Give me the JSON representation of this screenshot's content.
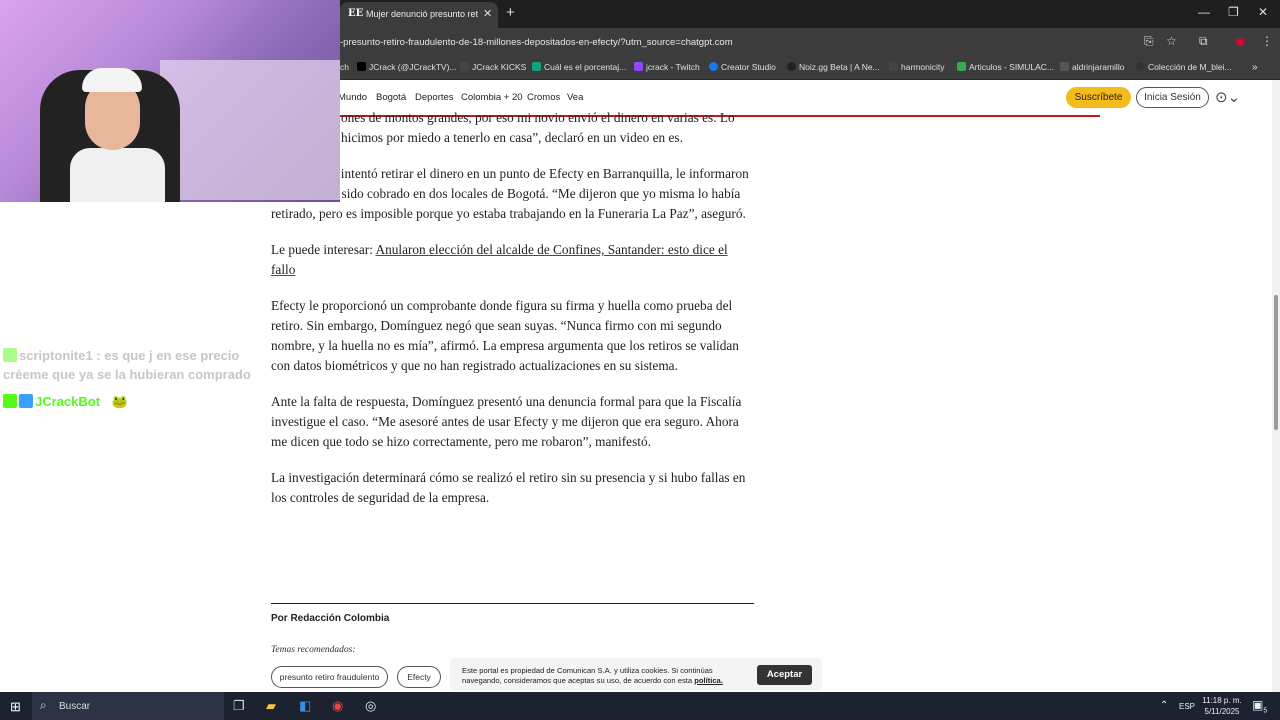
{
  "browser": {
    "tab_title": "Mujer denunció presunto retiro fraudulento",
    "tab_favicon": "EE",
    "url": "-presunto-retiro-fraudulento-de-18-millones-depositados-en-efecty/?utm_source=chatgpt.com",
    "bookmarks": [
      {
        "label": "ch",
        "icon_color": "#888"
      },
      {
        "label": "JCrack (@JCrackTV)...",
        "icon_color": "#000"
      },
      {
        "label": "JCrack KICKS",
        "icon_color": "#444"
      },
      {
        "label": "Cuál es el porcentaj...",
        "icon_color": "#10a37f"
      },
      {
        "label": "jcrack - Twitch",
        "icon_color": "#9146ff"
      },
      {
        "label": "Creator Studio",
        "icon_color": "#1877f2"
      },
      {
        "label": "Noiz.gg Beta | A Ne...",
        "icon_color": "#222"
      },
      {
        "label": "harmonicity",
        "icon_color": "#444"
      },
      {
        "label": "Articulos - SIMULAC...",
        "icon_color": "#34a853"
      },
      {
        "label": "aldrinjaramillo",
        "icon_color": "#555"
      },
      {
        "label": "Colección de M_blei...",
        "icon_color": "#333"
      }
    ]
  },
  "site": {
    "nav": [
      "Mundo",
      "Bogotá",
      "Deportes",
      "Colombia + 20",
      "Cromos",
      "Vea"
    ],
    "subscribe_label": "Suscríbete",
    "login_label": "Inicia Sesión"
  },
  "article": {
    "p1": "ones de montos grandes, por eso mi novio envió el dinero en varias es. Lo hicimos por miedo a tenerlo en casa”, declaró en un video en es.",
    "p2": "rero, cuando intentó retirar el dinero en un punto de Efecty en Barranquilla, le informaron que ya había sido cobrado en dos locales de Bogotá. “Me dijeron que yo misma lo había retirado, pero es imposible porque yo estaba trabajando en la Funeraria La Paz”, aseguró.",
    "p3_prefix": "Le puede interesar: ",
    "p3_link": "Anularon elección del alcalde de Confines, Santander: esto dice el fallo",
    "p4": "Efecty le proporcionó un comprobante donde figura su firma y huella como prueba del retiro. Sin embargo, Domínguez negó que sean suyas. “Nunca firmo con mi segundo nombre, y la huella no es mía”, afirmó. La empresa argumenta que los retiros se validan con datos biométricos y que no han registrado actualizaciones en su sistema.",
    "p5": "Ante la falta de respuesta, Domínguez presentó una denuncia formal para que la Fiscalía investigue el caso. “Me asesoré antes de usar Efecty y me dijeron que era seguro. Ahora me dicen que todo se hizo correctamente, pero me robaron”, manifestó.",
    "p6": "La investigación determinará cómo se realizó el retiro sin su presencia y si hubo fallas en los controles de seguridad de la empresa.",
    "byline": "Por Redacción Colombia",
    "temas_label": "Temas recomendados:",
    "tags": [
      "presunto retiro fraudulento",
      "Efecty"
    ]
  },
  "cookie": {
    "text": "Este portal es propiedad de Comunican S.A. y utiliza cookies. Si continúas navegando, consideramos que aceptas su uso, de acuerdo con esta",
    "link": "política.",
    "accept_label": "Aceptar"
  },
  "chat": [
    {
      "user": "scriptonite1",
      "sep": " : ",
      "message": "es que j en ese precio créeme que ya se la hubieran comprado",
      "user_color": "#c9c9c9",
      "badge_color": "#53fc18"
    },
    {
      "user": "JCrackBot",
      "sep": " : ",
      "message": "🐸",
      "user_color": "#53fc18",
      "badge_color": "#53fc18"
    }
  ],
  "taskbar": {
    "search_label": "Buscar",
    "lang": "ESP",
    "time": "11:18 p. m.",
    "date": "5/11/2025",
    "notif_count": "5"
  }
}
